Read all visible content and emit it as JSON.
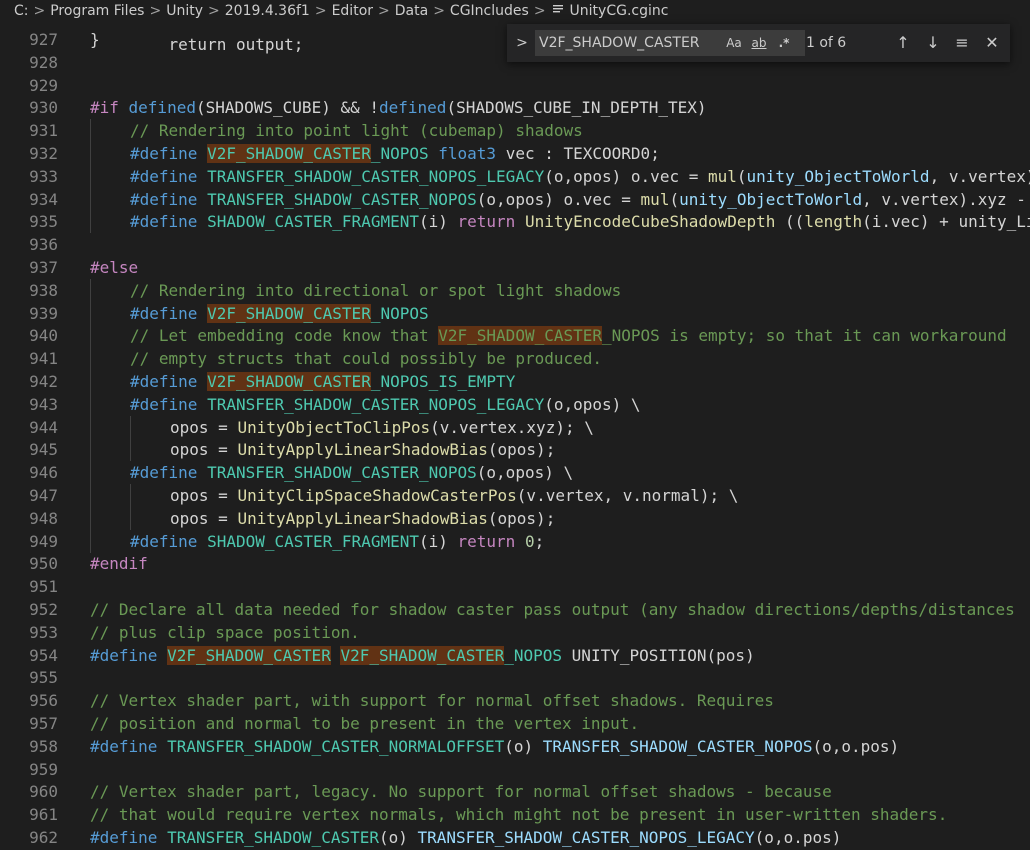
{
  "breadcrumb": {
    "items": [
      "C:",
      "Program Files",
      "Unity",
      "2019.4.36f1",
      "Editor",
      "Data",
      "CGIncludes"
    ],
    "file": "UnityCG.cginc",
    "separator": ">"
  },
  "find": {
    "toggle_icon": ">",
    "query": "V2F_SHADOW_CASTER",
    "match_case_label": "Aa",
    "whole_word_label": "ab",
    "regex_label": ".*",
    "count": "1 of 6",
    "prev_icon": "↑",
    "next_icon": "↓",
    "selection_icon": "≡",
    "close_icon": "✕"
  },
  "editor": {
    "lines": [
      {
        "num": "927",
        "indent": 0,
        "segs": [
          {
            "t": "}",
            "c": "c-id"
          }
        ]
      },
      {
        "num": "928",
        "indent": 0,
        "segs": []
      },
      {
        "num": "929",
        "indent": 0,
        "segs": []
      },
      {
        "num": "930",
        "indent": 0,
        "segs": [
          {
            "t": "#if ",
            "c": "c-pp"
          },
          {
            "t": "defined",
            "c": "c-kw"
          },
          {
            "t": "(SHADOWS_CUBE) && !",
            "c": "c-id"
          },
          {
            "t": "defined",
            "c": "c-kw"
          },
          {
            "t": "(SHADOWS_CUBE_IN_DEPTH_TEX)",
            "c": "c-id"
          }
        ]
      },
      {
        "num": "931",
        "indent": 1,
        "segs": [
          {
            "t": "// Rendering into point light (cubemap) shadows",
            "c": "c-cm"
          }
        ]
      },
      {
        "num": "932",
        "indent": 1,
        "segs": [
          {
            "t": "#define ",
            "c": "c-kw"
          },
          {
            "t": "V2F_SHADOW_CASTER",
            "c": "hl-def"
          },
          {
            "t": "_NOPOS ",
            "c": "c-def"
          },
          {
            "t": "float3",
            "c": "c-kw"
          },
          {
            "t": " vec : TEXCOORD0;",
            "c": "c-id"
          }
        ]
      },
      {
        "num": "933",
        "indent": 1,
        "segs": [
          {
            "t": "#define ",
            "c": "c-kw"
          },
          {
            "t": "TRANSFER_SHADOW_CASTER_NOPOS_LEGACY",
            "c": "c-def"
          },
          {
            "t": "(o,opos) o.vec = ",
            "c": "c-id"
          },
          {
            "t": "mul",
            "c": "c-fn"
          },
          {
            "t": "(",
            "c": "c-id"
          },
          {
            "t": "unity_ObjectToWorld",
            "c": "c-mac"
          },
          {
            "t": ", v.vertex).xyz - _LightPositionRange.xyz; opos = UnityObjectToClipPos(v.vertex);",
            "c": "c-id"
          }
        ]
      },
      {
        "num": "934",
        "indent": 1,
        "segs": [
          {
            "t": "#define ",
            "c": "c-kw"
          },
          {
            "t": "TRANSFER_SHADOW_CASTER_NOPOS",
            "c": "c-def"
          },
          {
            "t": "(o,opos) o.vec = ",
            "c": "c-id"
          },
          {
            "t": "mul",
            "c": "c-fn"
          },
          {
            "t": "(",
            "c": "c-id"
          },
          {
            "t": "unity_ObjectToWorld",
            "c": "c-mac"
          },
          {
            "t": ", v.vertex).xyz - _LightPositionRange.xyz;",
            "c": "c-id"
          }
        ]
      },
      {
        "num": "935",
        "indent": 1,
        "segs": [
          {
            "t": "#define ",
            "c": "c-kw"
          },
          {
            "t": "SHADOW_CASTER_FRAGMENT",
            "c": "c-def"
          },
          {
            "t": "(i) ",
            "c": "c-id"
          },
          {
            "t": "return ",
            "c": "c-pp"
          },
          {
            "t": "UnityEncodeCubeShadowDepth",
            "c": "c-fn"
          },
          {
            "t": " ((",
            "c": "c-id"
          },
          {
            "t": "length",
            "c": "c-fn"
          },
          {
            "t": "(i.vec) + unity_LightShadowBias.x) * _LightPositionRange.w);",
            "c": "c-id"
          }
        ]
      },
      {
        "num": "936",
        "indent": 0,
        "segs": []
      },
      {
        "num": "937",
        "indent": 0,
        "segs": [
          {
            "t": "#else",
            "c": "c-pp"
          }
        ]
      },
      {
        "num": "938",
        "indent": 1,
        "segs": [
          {
            "t": "// Rendering into directional or spot light shadows",
            "c": "c-cm"
          }
        ]
      },
      {
        "num": "939",
        "indent": 1,
        "segs": [
          {
            "t": "#define ",
            "c": "c-kw"
          },
          {
            "t": "V2F_SHADOW_CASTER",
            "c": "hl-def"
          },
          {
            "t": "_NOPOS",
            "c": "c-def"
          }
        ]
      },
      {
        "num": "940",
        "indent": 1,
        "segs": [
          {
            "t": "// Let embedding code know that ",
            "c": "c-cm"
          },
          {
            "t": "V2F_SHADOW_CASTER",
            "c": "c-cm hl"
          },
          {
            "t": "_NOPOS is empty; so that it can workaround",
            "c": "c-cm"
          }
        ]
      },
      {
        "num": "941",
        "indent": 1,
        "segs": [
          {
            "t": "// empty structs that could possibly be produced.",
            "c": "c-cm"
          }
        ]
      },
      {
        "num": "942",
        "indent": 1,
        "segs": [
          {
            "t": "#define ",
            "c": "c-kw"
          },
          {
            "t": "V2F_SHADOW_CASTER",
            "c": "hl-def"
          },
          {
            "t": "_NOPOS_IS_EMPTY",
            "c": "c-def"
          }
        ]
      },
      {
        "num": "943",
        "indent": 1,
        "segs": [
          {
            "t": "#define ",
            "c": "c-kw"
          },
          {
            "t": "TRANSFER_SHADOW_CASTER_NOPOS_LEGACY",
            "c": "c-def"
          },
          {
            "t": "(o,opos) \\",
            "c": "c-id"
          }
        ]
      },
      {
        "num": "944",
        "indent": 2,
        "segs": [
          {
            "t": "opos = ",
            "c": "c-id"
          },
          {
            "t": "UnityObjectToClipPos",
            "c": "c-fn"
          },
          {
            "t": "(v.vertex.xyz); \\",
            "c": "c-id"
          }
        ]
      },
      {
        "num": "945",
        "indent": 2,
        "segs": [
          {
            "t": "opos = ",
            "c": "c-id"
          },
          {
            "t": "UnityApplyLinearShadowBias",
            "c": "c-fn"
          },
          {
            "t": "(opos);",
            "c": "c-id"
          }
        ]
      },
      {
        "num": "946",
        "indent": 1,
        "segs": [
          {
            "t": "#define ",
            "c": "c-kw"
          },
          {
            "t": "TRANSFER_SHADOW_CASTER_NOPOS",
            "c": "c-def"
          },
          {
            "t": "(o,opos) \\",
            "c": "c-id"
          }
        ]
      },
      {
        "num": "947",
        "indent": 2,
        "segs": [
          {
            "t": "opos = ",
            "c": "c-id"
          },
          {
            "t": "UnityClipSpaceShadowCasterPos",
            "c": "c-fn"
          },
          {
            "t": "(v.vertex, v.normal); \\",
            "c": "c-id"
          }
        ]
      },
      {
        "num": "948",
        "indent": 2,
        "segs": [
          {
            "t": "opos = ",
            "c": "c-id"
          },
          {
            "t": "UnityApplyLinearShadowBias",
            "c": "c-fn"
          },
          {
            "t": "(opos);",
            "c": "c-id"
          }
        ]
      },
      {
        "num": "949",
        "indent": 1,
        "segs": [
          {
            "t": "#define ",
            "c": "c-kw"
          },
          {
            "t": "SHADOW_CASTER_FRAGMENT",
            "c": "c-def"
          },
          {
            "t": "(i) ",
            "c": "c-id"
          },
          {
            "t": "return ",
            "c": "c-pp"
          },
          {
            "t": "0",
            "c": "c-num"
          },
          {
            "t": ";",
            "c": "c-id"
          }
        ]
      },
      {
        "num": "950",
        "indent": 0,
        "segs": [
          {
            "t": "#endif",
            "c": "c-pp"
          }
        ]
      },
      {
        "num": "951",
        "indent": 0,
        "segs": []
      },
      {
        "num": "952",
        "indent": 0,
        "segs": [
          {
            "t": "// Declare all data needed for shadow caster pass output (any shadow directions/depths/distances",
            "c": "c-cm"
          }
        ]
      },
      {
        "num": "953",
        "indent": 0,
        "segs": [
          {
            "t": "// plus clip space position.",
            "c": "c-cm"
          }
        ]
      },
      {
        "num": "954",
        "indent": 0,
        "segs": [
          {
            "t": "#define ",
            "c": "c-kw"
          },
          {
            "t": "V2F_SHADOW_CASTER",
            "c": "hl-def"
          },
          {
            "t": " ",
            "c": "c-id"
          },
          {
            "t": "V2F_SHADOW_CASTER",
            "c": "hl-def"
          },
          {
            "t": "_NOPOS ",
            "c": "c-def"
          },
          {
            "t": "UNITY_POSITION(pos)",
            "c": "c-id"
          }
        ]
      },
      {
        "num": "955",
        "indent": 0,
        "segs": []
      },
      {
        "num": "956",
        "indent": 0,
        "segs": [
          {
            "t": "// Vertex shader part, with support for normal offset shadows. Requires",
            "c": "c-cm"
          }
        ]
      },
      {
        "num": "957",
        "indent": 0,
        "segs": [
          {
            "t": "// position and normal to be present in the vertex input.",
            "c": "c-cm"
          }
        ]
      },
      {
        "num": "958",
        "indent": 0,
        "segs": [
          {
            "t": "#define ",
            "c": "c-kw"
          },
          {
            "t": "TRANSFER_SHADOW_CASTER_NORMALOFFSET",
            "c": "c-def"
          },
          {
            "t": "(o) ",
            "c": "c-id"
          },
          {
            "t": "TRANSFER_SHADOW_CASTER_NOPOS",
            "c": "c-mac"
          },
          {
            "t": "(o,o.pos)",
            "c": "c-id"
          }
        ]
      },
      {
        "num": "959",
        "indent": 0,
        "segs": []
      },
      {
        "num": "960",
        "indent": 0,
        "segs": [
          {
            "t": "// Vertex shader part, legacy. No support for normal offset shadows - because",
            "c": "c-cm"
          }
        ]
      },
      {
        "num": "961",
        "indent": 0,
        "segs": [
          {
            "t": "// that would require vertex normals, which might not be present in user-written shaders.",
            "c": "c-cm"
          }
        ]
      },
      {
        "num": "962",
        "indent": 0,
        "segs": [
          {
            "t": "#define ",
            "c": "c-kw"
          },
          {
            "t": "TRANSFER_SHADOW_CASTER",
            "c": "c-def"
          },
          {
            "t": "(o) ",
            "c": "c-id"
          },
          {
            "t": "TRANSFER_SHADOW_CASTER_NOPOS_LEGACY",
            "c": "c-mac"
          },
          {
            "t": "(o,o.pos)",
            "c": "c-id"
          }
        ]
      }
    ]
  }
}
